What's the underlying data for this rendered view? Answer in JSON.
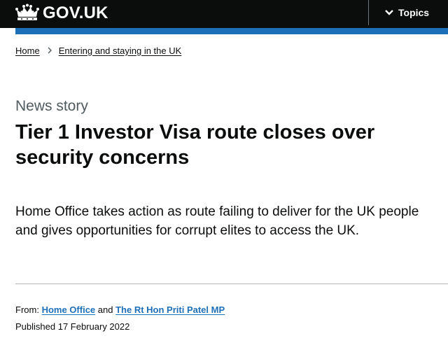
{
  "header": {
    "logo_text": "GOV.UK",
    "topics_label": "Topics"
  },
  "breadcrumb": {
    "items": [
      {
        "label": "Home"
      },
      {
        "label": "Entering and staying in the UK"
      }
    ]
  },
  "article": {
    "caption": "News story",
    "title": "Tier 1 Investor Visa route closes over security concerns",
    "lead": "Home Office takes action as route failing to deliver for the UK people and gives opportunities for corrupt elites to access the UK."
  },
  "metadata": {
    "from_label": "From:",
    "org_1": "Home Office",
    "and_text": "and",
    "org_2": "The Rt Hon Priti Patel MP",
    "published_label": "Published",
    "published_date": "17 February 2022"
  },
  "colors": {
    "header_bg": "#0b0c0c",
    "brand_blue": "#1d70b8",
    "caption_grey": "#505a5f",
    "rule_grey": "#b1b4b6"
  },
  "icons": {
    "logo": "crown-icon",
    "topics": "chevron-down-icon",
    "breadcrumb_separator": "chevron-right-icon"
  }
}
